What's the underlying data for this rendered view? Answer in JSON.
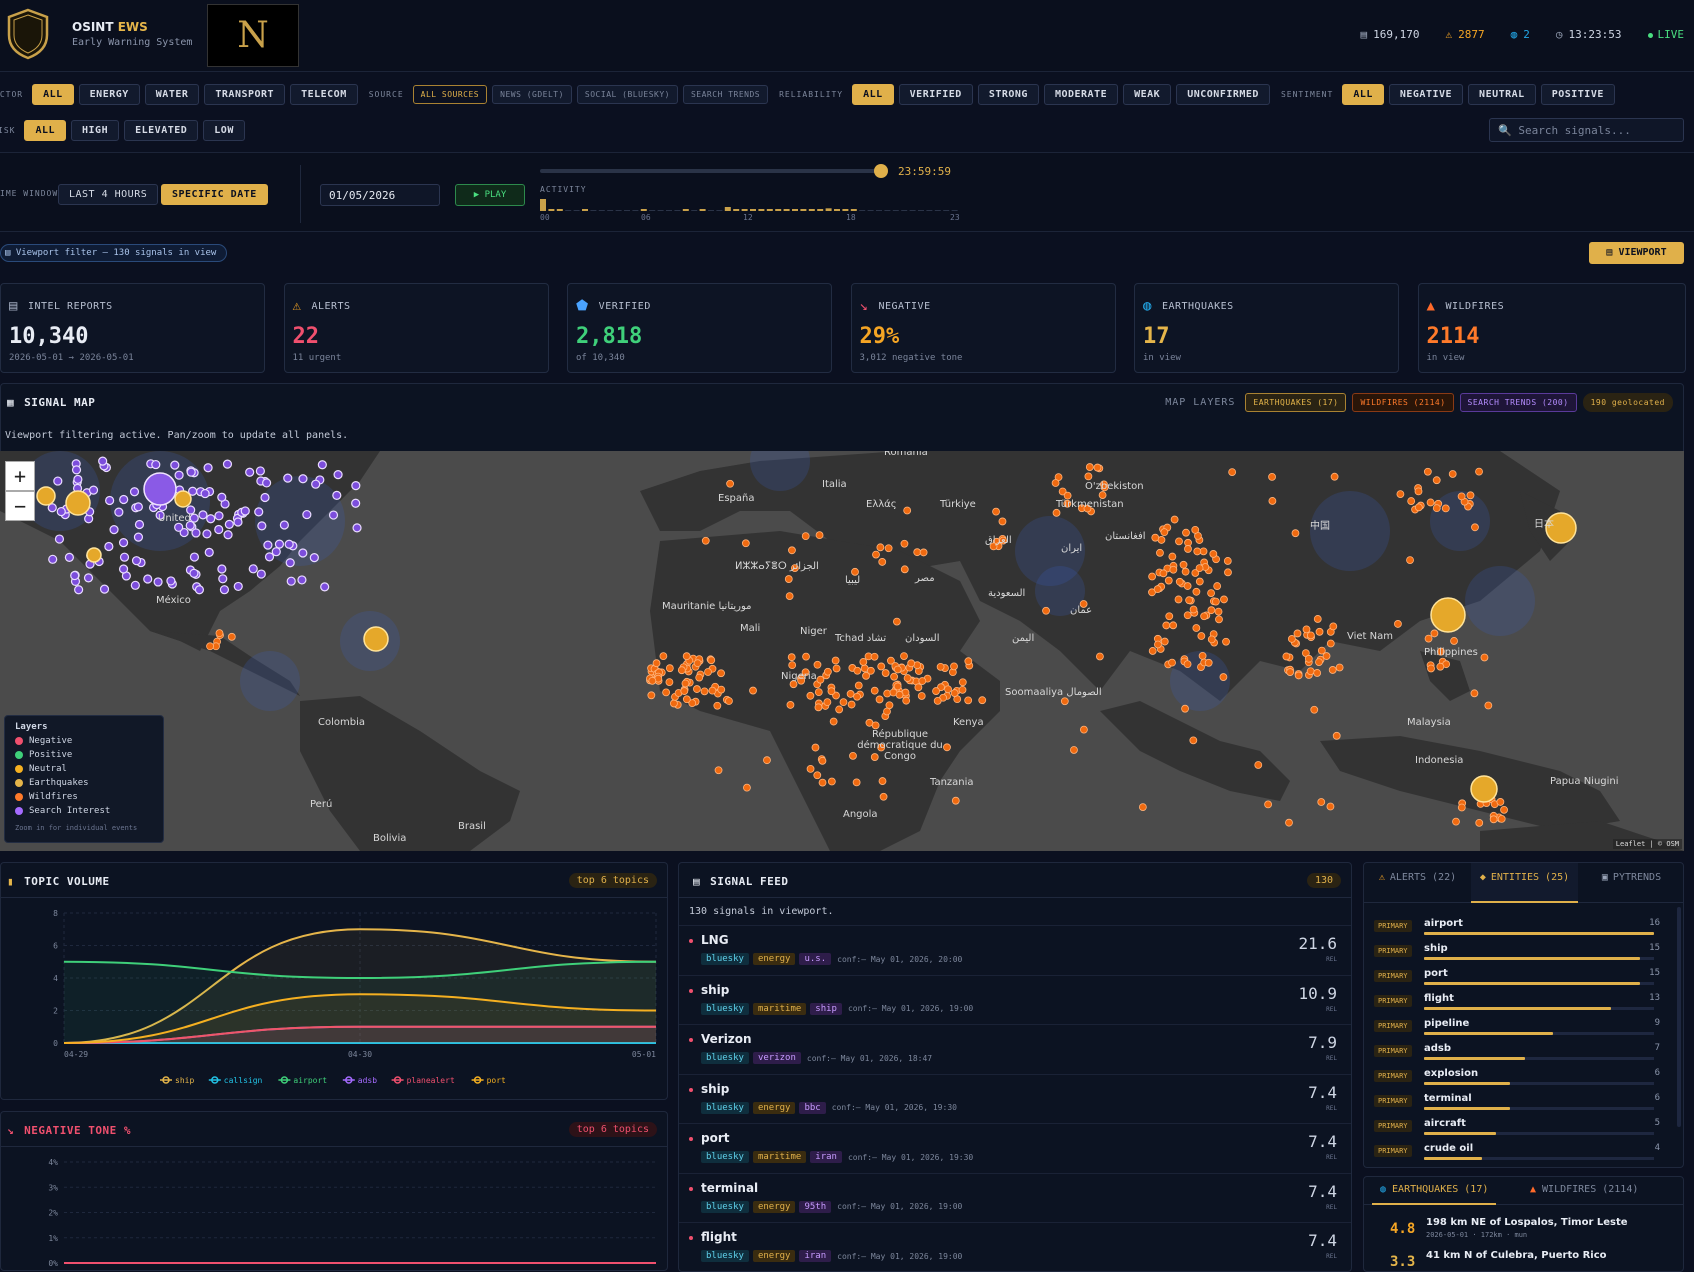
{
  "header": {
    "brand_prefix": "OSINT",
    "brand_suffix": "EWS",
    "subtitle": "Early Warning System",
    "logo_letter": "N",
    "stats": [
      {
        "icon": "report-icon",
        "value": "169,170"
      },
      {
        "icon": "alert-icon",
        "value": "2877"
      },
      {
        "icon": "globe-icon",
        "value": "2"
      },
      {
        "icon": "clock-icon",
        "value": "13:23:53"
      }
    ],
    "live": "LIVE"
  },
  "filters": {
    "sector": {
      "label": "ECTOR",
      "items": [
        "ALL",
        "ENERGY",
        "WATER",
        "TRANSPORT",
        "TELECOM"
      ]
    },
    "source": {
      "label": "SOURCE",
      "items": [
        "ALL SOURCES",
        "NEWS (GDELT)",
        "SOCIAL (BLUESKY)",
        "SEARCH TRENDS"
      ]
    },
    "reliability": {
      "label": "RELIABILITY",
      "items": [
        "ALL",
        "VERIFIED",
        "STRONG",
        "MODERATE",
        "WEAK",
        "UNCONFIRMED"
      ]
    },
    "sentiment": {
      "label": "SENTIMENT",
      "items": [
        "ALL",
        "NEGATIVE",
        "NEUTRAL",
        "POSITIVE"
      ]
    },
    "risk": {
      "label": "ISK",
      "items": [
        "ALL",
        "HIGH",
        "ELEVATED",
        "LOW"
      ]
    },
    "search_placeholder": "Search signals..."
  },
  "timewindow": {
    "label": "IME WINDOW",
    "options": [
      "LAST 4 HOURS",
      "SPECIFIC DATE"
    ],
    "date": "01/05/2026",
    "play": "▶ PLAY",
    "time": "23:59:59",
    "slider_fraction": 1.0,
    "activity_label": "ACTIVITY",
    "activity": [
      9,
      1,
      1,
      0,
      0,
      1,
      0,
      0,
      0,
      0,
      0,
      0,
      1,
      0,
      0,
      0,
      0,
      1,
      0,
      1,
      0,
      0,
      3,
      1,
      1,
      1,
      1,
      1,
      1,
      1,
      1,
      1,
      1,
      1,
      2,
      1,
      1,
      1,
      0,
      0,
      0,
      0,
      0,
      0,
      0,
      0,
      0,
      0,
      0,
      0
    ],
    "ticks": [
      "00",
      "06",
      "12",
      "18",
      "23"
    ]
  },
  "viewport": {
    "filter_text": "Viewport filter — 130 signals in view",
    "button": "VIEWPORT"
  },
  "kpis": [
    {
      "icon": "report-icon",
      "label": "INTEL REPORTS",
      "value": "10,340",
      "sub": "2026-05-01 → 2026-05-01",
      "color": "#e8ecf4"
    },
    {
      "icon": "alert-icon",
      "label": "ALERTS",
      "value": "22",
      "sub": "11 urgent",
      "color": "#f0506e"
    },
    {
      "icon": "shield-icon",
      "label": "VERIFIED",
      "value": "2,818",
      "sub": "of 10,340",
      "color": "#3fd07a"
    },
    {
      "icon": "trend-down-icon",
      "label": "NEGATIVE",
      "value": "29%",
      "sub": "3,012 negative tone",
      "color": "#f5a524"
    },
    {
      "icon": "globe-icon",
      "label": "EARTHQUAKES",
      "value": "17",
      "sub": "in view",
      "color": "#e5b54a"
    },
    {
      "icon": "fire-icon",
      "label": "WILDFIRES",
      "value": "2114",
      "sub": "in view",
      "color": "#ff7a2a"
    }
  ],
  "map": {
    "title": "SIGNAL MAP",
    "layers_label": "MAP LAYERS",
    "layers": [
      "EARTHQUAKES (17)",
      "WILDFIRES (2114)",
      "SEARCH TRENDS (200)"
    ],
    "geolocated": "190 geolocated",
    "note": "Viewport filtering active. Pan/zoom to update all panels.",
    "zoom_in": "+",
    "zoom_out": "−",
    "attribution": "Leaflet | © OSM",
    "legend_title": "Layers",
    "legend": [
      {
        "label": "Negative",
        "color": "#f0506e"
      },
      {
        "label": "Positive",
        "color": "#3fd07a"
      },
      {
        "label": "Neutral",
        "color": "#f5b021"
      },
      {
        "label": "Earthquakes",
        "color": "#e5b54a"
      },
      {
        "label": "Wildfires",
        "color": "#ff7a2a"
      },
      {
        "label": "Search Interest",
        "color": "#a56bff"
      }
    ],
    "legend_hint": "Zoom in for individual events",
    "labels": [
      {
        "t": "Romania"
      },
      {
        "t": "España"
      },
      {
        "t": "Italia"
      },
      {
        "t": "Ελλάς"
      },
      {
        "t": "Türkiye"
      },
      {
        "t": "Türkmenistan"
      },
      {
        "t": "O'zbekiston"
      },
      {
        "t": "United"
      },
      {
        "t": "México"
      },
      {
        "t": "ⵍⵣⵣⴰⵢⴻⵔ الجزائر"
      },
      {
        "t": "ليبيا"
      },
      {
        "t": "مصر"
      },
      {
        "t": "العراق"
      },
      {
        "t": "ایران"
      },
      {
        "t": "افغانستان"
      },
      {
        "t": "السعودية"
      },
      {
        "t": "عمان"
      },
      {
        "t": "中国"
      },
      {
        "t": "日本"
      },
      {
        "t": "Mauritanie موريتانيا"
      },
      {
        "t": "Mali"
      },
      {
        "t": "Niger"
      },
      {
        "t": "Tchad تشاد"
      },
      {
        "t": "السودان"
      },
      {
        "t": "اليمن"
      },
      {
        "t": "Nigeria"
      },
      {
        "t": "Soomaaliya الصومال"
      },
      {
        "t": "Kenya"
      },
      {
        "t": "République démocratique du Congo"
      },
      {
        "t": "Tanzania"
      },
      {
        "t": "Angola"
      },
      {
        "t": "Colombia"
      },
      {
        "t": "Perú"
      },
      {
        "t": "Brasil"
      },
      {
        "t": "Bolivia"
      },
      {
        "t": "Viet Nam"
      },
      {
        "t": "Philippines"
      },
      {
        "t": "Malaysia"
      },
      {
        "t": "Indonesia"
      },
      {
        "t": "Papua Niugini"
      }
    ]
  },
  "topic_volume": {
    "title": "TOPIC VOLUME",
    "badge": "top 6 topics"
  },
  "negative_tone": {
    "title": "NEGATIVE TONE %",
    "badge": "top 6 topics"
  },
  "chart_data": [
    {
      "type": "area",
      "x": [
        "04-29",
        "04-30",
        "05-01"
      ],
      "ylim": [
        0,
        8
      ],
      "yticks": [
        0,
        2,
        4,
        6,
        8
      ],
      "series": [
        {
          "name": "ship",
          "color": "#e5b54a",
          "values": [
            0,
            7,
            5
          ]
        },
        {
          "name": "callsign",
          "color": "#22c3e6",
          "values": [
            0,
            0,
            0
          ]
        },
        {
          "name": "airport",
          "color": "#3fd07a",
          "values": [
            5,
            4,
            5
          ]
        },
        {
          "name": "adsb",
          "color": "#a56bff",
          "values": [
            0,
            1,
            1
          ]
        },
        {
          "name": "planealert",
          "color": "#f0506e",
          "values": [
            0,
            1,
            1
          ]
        },
        {
          "name": "port",
          "color": "#f5b021",
          "values": [
            0,
            3,
            2
          ]
        }
      ]
    },
    {
      "type": "line",
      "yticks": [
        "0%",
        "1%",
        "2%",
        "3%",
        "4%"
      ],
      "ylim": [
        0,
        4
      ],
      "series": [
        {
          "color": "#f0506e",
          "values": [
            0,
            0,
            0
          ]
        }
      ]
    }
  ],
  "feed": {
    "title": "SIGNAL FEED",
    "count": "130",
    "note": "130 signals in viewport.",
    "rel": "REL",
    "items": [
      {
        "name": "LNG",
        "tags": [
          "bluesky",
          "energy",
          "u.s."
        ],
        "meta": "conf:— May 01, 2026, 20:00",
        "score": "21.6"
      },
      {
        "name": "ship",
        "tags": [
          "bluesky",
          "maritime",
          "ship"
        ],
        "meta": "conf:— May 01, 2026, 19:00",
        "score": "10.9"
      },
      {
        "name": "Verizon",
        "tags": [
          "bluesky",
          "verizon"
        ],
        "meta": "conf:— May 01, 2026, 18:47",
        "score": "7.9"
      },
      {
        "name": "ship",
        "tags": [
          "bluesky",
          "energy",
          "bbc"
        ],
        "meta": "conf:— May 01, 2026, 19:30",
        "score": "7.4"
      },
      {
        "name": "port",
        "tags": [
          "bluesky",
          "maritime",
          "iran"
        ],
        "meta": "conf:— May 01, 2026, 19:30",
        "score": "7.4"
      },
      {
        "name": "terminal",
        "tags": [
          "bluesky",
          "energy",
          "95th"
        ],
        "meta": "conf:— May 01, 2026, 19:00",
        "score": "7.4"
      },
      {
        "name": "flight",
        "tags": [
          "bluesky",
          "energy",
          "iran"
        ],
        "meta": "conf:— May 01, 2026, 19:00",
        "score": "7.4"
      }
    ]
  },
  "side": {
    "tabs": [
      "ALERTS (22)",
      "ENTITIES (25)",
      "PYTRENDS"
    ],
    "primary": "PRIMARY",
    "entities": [
      {
        "n": "airport",
        "c": 16
      },
      {
        "n": "ship",
        "c": 15
      },
      {
        "n": "port",
        "c": 15
      },
      {
        "n": "flight",
        "c": 13
      },
      {
        "n": "pipeline",
        "c": 9
      },
      {
        "n": "adsb",
        "c": 7
      },
      {
        "n": "explosion",
        "c": 6
      },
      {
        "n": "terminal",
        "c": 6
      },
      {
        "n": "aircraft",
        "c": 5
      },
      {
        "n": "crude oil",
        "c": 4
      }
    ],
    "tabs2": [
      "EARTHQUAKES (17)",
      "WILDFIRES (2114)"
    ],
    "quakes": [
      {
        "mag": "4.8",
        "place": "198 km NE of Lospalos, Timor Leste",
        "meta": "2026-05-01 · 172km · mun"
      },
      {
        "mag": "3.3",
        "place": "41 km N of Culebra, Puerto Rico",
        "meta": ""
      }
    ]
  }
}
